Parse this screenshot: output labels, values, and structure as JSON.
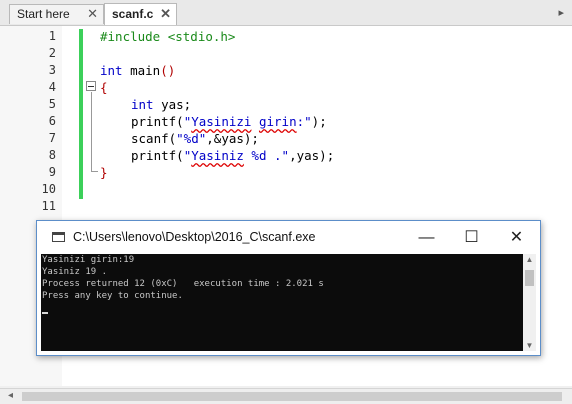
{
  "tabs": [
    {
      "label": "Start here",
      "close": "✕"
    },
    {
      "label": "scanf.c",
      "close": "✕"
    }
  ],
  "scroll_arrow": "▸",
  "editor": {
    "line_numbers": [
      "1",
      "2",
      "3",
      "4",
      "5",
      "6",
      "7",
      "8",
      "9",
      "10",
      "11"
    ],
    "lines": {
      "l1": "#include <stdio.h>",
      "l3_kw": "int",
      "l3_rest": " main",
      "l3_paren": "()",
      "l4": "{",
      "l5_kw": "int",
      "l5_rest": " yas;",
      "l6_a": "printf(",
      "l6_str_q": "\"",
      "l6_str_w1": "Yasinizi",
      "l6_str_sp": " ",
      "l6_str_w2": "girin",
      "l6_str_tail": ":\"",
      "l6_b": ");",
      "l7_a": "scanf(",
      "l7_str": "\"%d\"",
      "l7_b": ",&yas);",
      "l8_a": "printf(",
      "l8_str_q": "\"",
      "l8_str_w1": "Yasiniz",
      "l8_str_tail": " %d .\"",
      "l8_b": ",yas);",
      "l9": "}"
    }
  },
  "console": {
    "title": "C:\\Users\\lenovo\\Desktop\\2016_C\\scanf.exe",
    "minimize": "—",
    "maximize": "☐",
    "close": "✕",
    "output": [
      "Yasinizi girin:19",
      "Yasiniz 19 .",
      "Process returned 12 (0xC)   execution time : 2.021 s",
      "Press any key to continue."
    ]
  },
  "hscroll_arrow": "◂"
}
